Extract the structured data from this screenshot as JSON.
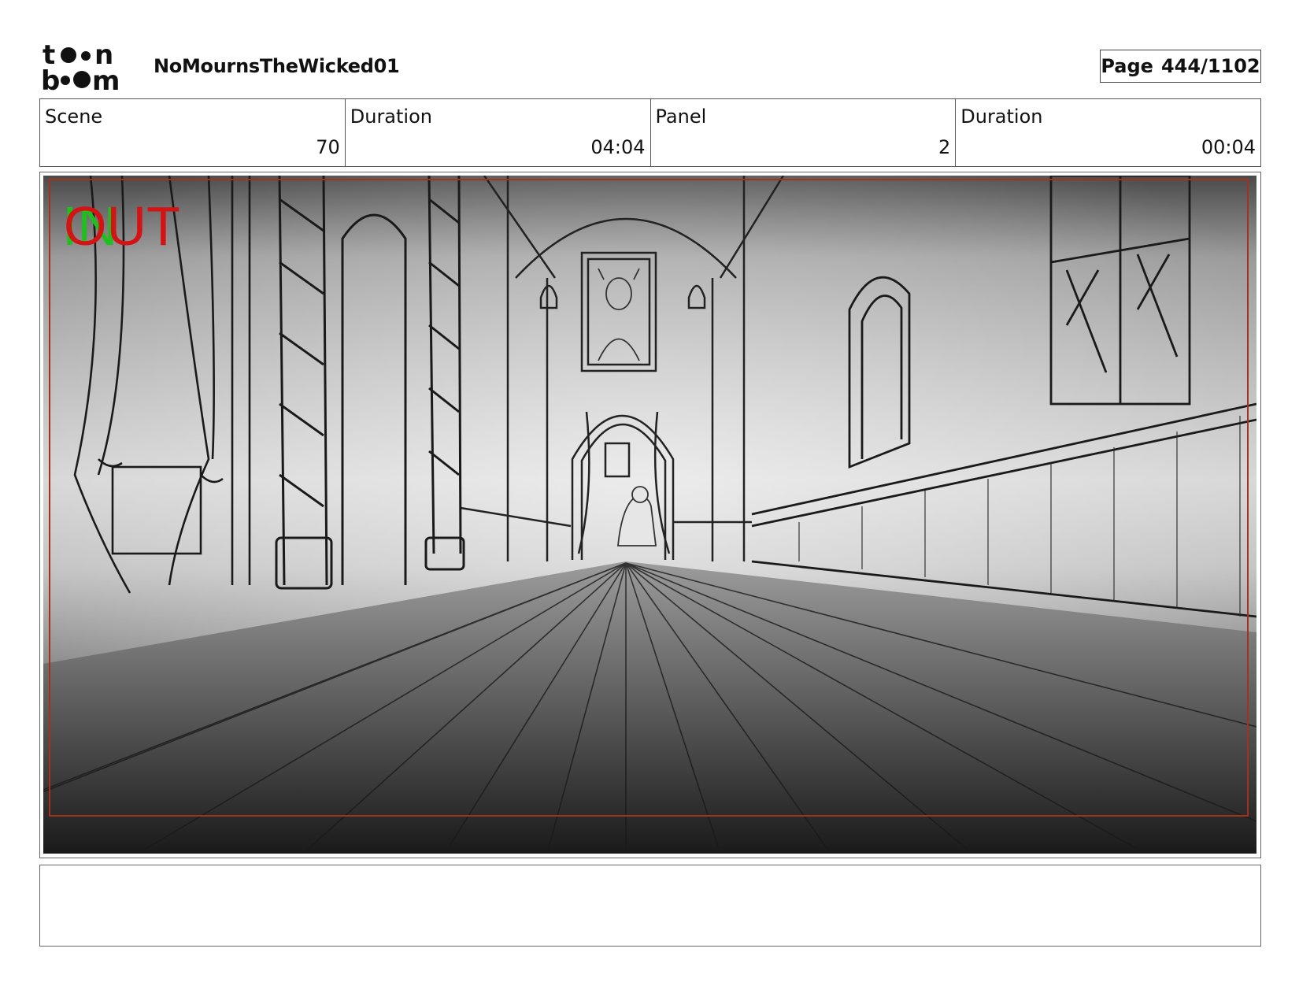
{
  "header": {
    "logo_text_top": "toon",
    "logo_text_bottom": "boom",
    "project_title": "NoMournsTheWicked01",
    "page_label": "Page",
    "page_number": "444/1102"
  },
  "info": [
    {
      "label": "Scene",
      "value": "70"
    },
    {
      "label": "Duration",
      "value": "04:04"
    },
    {
      "label": "Panel",
      "value": "2"
    },
    {
      "label": "Duration",
      "value": "00:04"
    }
  ],
  "panel": {
    "in_marker": "IN",
    "out_marker": "OUT",
    "in_color": "#1fbf1f",
    "out_color": "#d41414",
    "safe_frame_color": "#a0331f"
  },
  "caption": {
    "text": ""
  }
}
